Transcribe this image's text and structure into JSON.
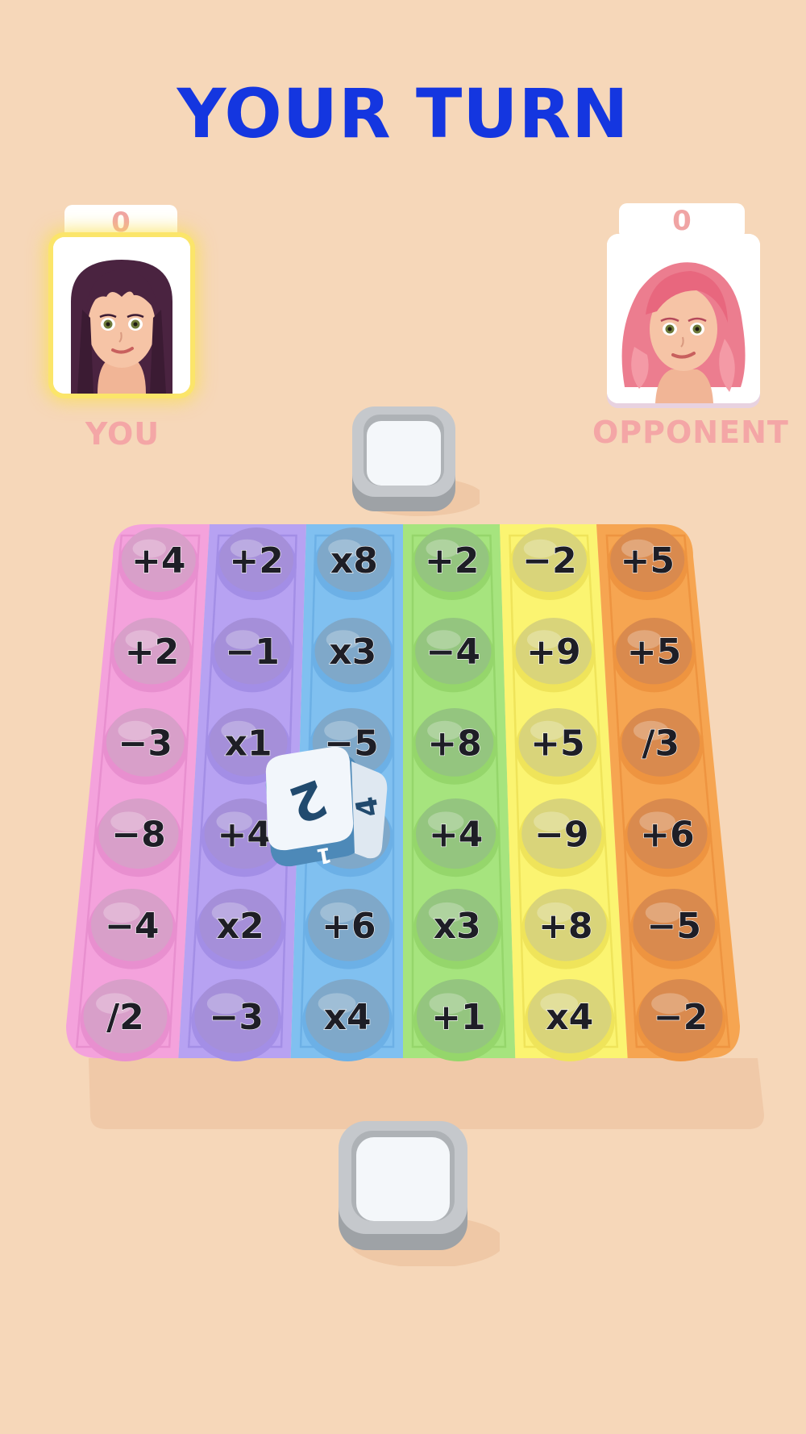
{
  "header": {
    "turn_text": "YOUR TURN"
  },
  "players": {
    "you": {
      "score": "0",
      "label": "YOU",
      "active": true
    },
    "opponent": {
      "score": "0",
      "label": "OPPONENT",
      "active": false
    }
  },
  "board": {
    "columns": [
      {
        "color": "pink",
        "fill": "#f4a2dc",
        "dark": "#e88fcf",
        "bubble": "#d89fc9",
        "cells": [
          "+4",
          "+2",
          "−3",
          "−8",
          "−4",
          "/2"
        ]
      },
      {
        "color": "purple",
        "fill": "#b7a2f2",
        "dark": "#a38ee6",
        "bubble": "#a58fd9",
        "cells": [
          "+2",
          "−1",
          "x1",
          "+4",
          "x2",
          "−3"
        ]
      },
      {
        "color": "blue",
        "fill": "#80c0f0",
        "dark": "#6cb0e6",
        "bubble": "#7fa8c9",
        "cells": [
          "x8",
          "x3",
          "−5",
          "",
          "+6",
          "x4"
        ]
      },
      {
        "color": "green",
        "fill": "#a6e47e",
        "dark": "#95d66b",
        "bubble": "#94c57f",
        "cells": [
          "+2",
          "−4",
          "+8",
          "+4",
          "x3",
          "+1"
        ]
      },
      {
        "color": "yellow",
        "fill": "#fbf471",
        "dark": "#efe45a",
        "bubble": "#d9d47a",
        "cells": [
          "−2",
          "+9",
          "+5",
          "−9",
          "+8",
          "x4"
        ]
      },
      {
        "color": "orange",
        "fill": "#f6a551",
        "dark": "#ee9440",
        "bubble": "#d98a4e",
        "cells": [
          "+5",
          "+5",
          "/3",
          "+6",
          "−5",
          "−2"
        ]
      }
    ]
  },
  "dice": {
    "face_front": "2",
    "face_side": "4",
    "face_bottom": "1"
  }
}
